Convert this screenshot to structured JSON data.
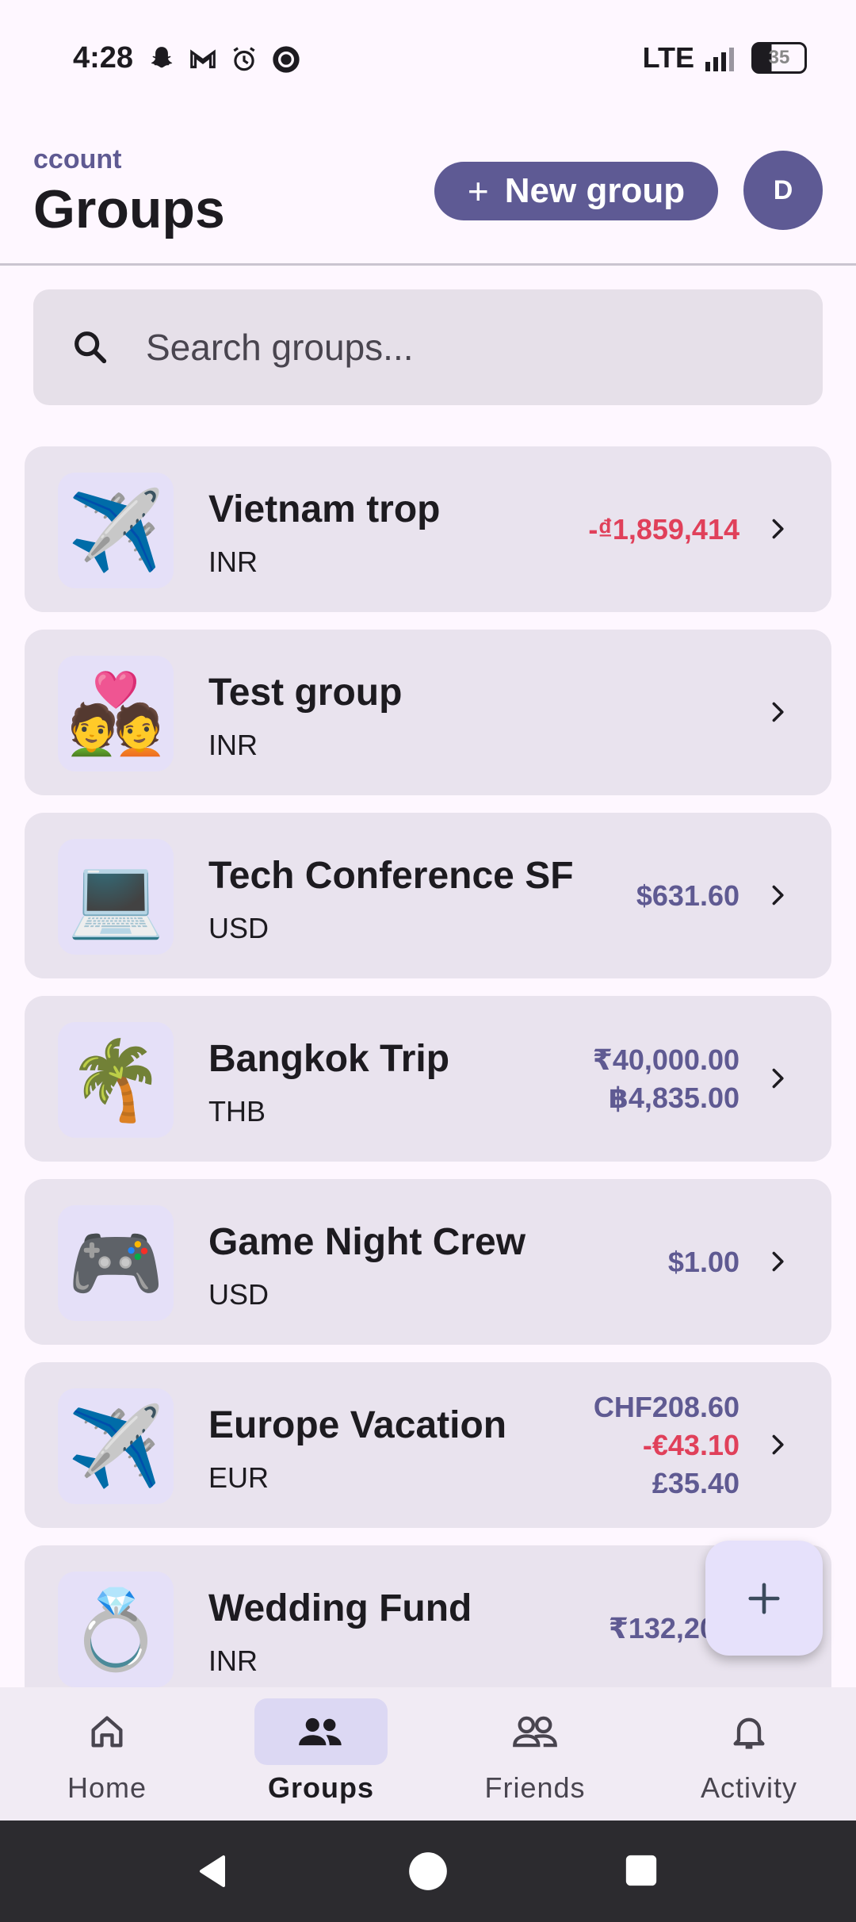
{
  "status_bar": {
    "time": "4:28",
    "network": "LTE",
    "battery": "35",
    "notification_icons": [
      "snapchat-icon",
      "gmail-icon",
      "alarm-icon",
      "circle-app-icon"
    ]
  },
  "header": {
    "app_name_partial": "ccount",
    "title": "Groups",
    "new_group_label": "New group",
    "avatar_initial": "D"
  },
  "search": {
    "placeholder": "Search groups..."
  },
  "groups": [
    {
      "emoji": "✈️",
      "icon": "airplane-icon",
      "name": "Vietnam trop",
      "currency": "INR",
      "balances": [
        {
          "text": "-₫1,859,414",
          "negative": true
        }
      ]
    },
    {
      "emoji": "💑",
      "icon": "couple-heart-icon",
      "name": "Test group",
      "currency": "INR",
      "balances": []
    },
    {
      "emoji": "💻",
      "icon": "laptop-icon",
      "name": "Tech Conference SF",
      "currency": "USD",
      "balances": [
        {
          "text": "$631.60",
          "negative": false
        }
      ]
    },
    {
      "emoji": "🌴",
      "icon": "palm-tree-icon",
      "name": "Bangkok Trip",
      "currency": "THB",
      "balances": [
        {
          "text": "₹40,000.00",
          "negative": false
        },
        {
          "text": "฿4,835.00",
          "negative": false
        }
      ]
    },
    {
      "emoji": "🎮",
      "icon": "gamepad-icon",
      "name": "Game Night Crew",
      "currency": "USD",
      "balances": [
        {
          "text": "$1.00",
          "negative": false
        }
      ]
    },
    {
      "emoji": "✈️",
      "icon": "airplane-icon",
      "name": "Europe Vacation",
      "currency": "EUR",
      "balances": [
        {
          "text": "CHF208.60",
          "negative": false
        },
        {
          "text": "-€43.10",
          "negative": true
        },
        {
          "text": "£35.40",
          "negative": false
        }
      ]
    },
    {
      "emoji": "💍",
      "icon": "ring-icon",
      "name": "Wedding Fund",
      "currency": "INR",
      "balances": [
        {
          "text": "₹132,200.",
          "negative": false
        }
      ]
    }
  ],
  "bottom_nav": [
    {
      "label": "Home",
      "icon": "home-icon",
      "active": false
    },
    {
      "label": "Groups",
      "icon": "groups-icon",
      "active": true
    },
    {
      "label": "Friends",
      "icon": "friends-icon",
      "active": false
    },
    {
      "label": "Activity",
      "icon": "bell-icon",
      "active": false
    }
  ],
  "colors": {
    "primary": "#5e5a94",
    "negative": "#e0405a",
    "card_bg": "#e9e3ee"
  }
}
